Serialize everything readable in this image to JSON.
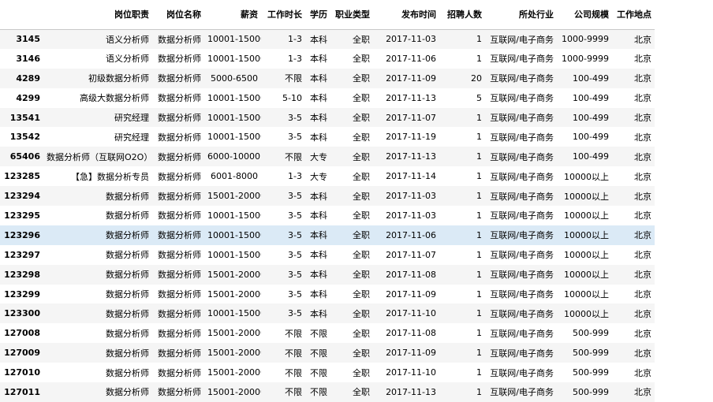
{
  "table": {
    "columns": [
      "",
      "岗位职责",
      "岗位名称",
      "薪资",
      "工作时长",
      "学历",
      "职业类型",
      "发布时间",
      "招聘人数",
      "所处行业",
      "公司规模",
      "工作地点"
    ],
    "rows": [
      [
        "3145",
        "语义分析师",
        "数据分析师",
        "10001-15000",
        "1-3",
        "本科",
        "全职",
        "2017-11-03",
        "1",
        "互联网/电子商务",
        "1000-9999",
        "北京"
      ],
      [
        "3146",
        "语义分析师",
        "数据分析师",
        "10001-15000",
        "1-3",
        "本科",
        "全职",
        "2017-11-06",
        "1",
        "互联网/电子商务",
        "1000-9999",
        "北京"
      ],
      [
        "4289",
        "初级数据分析师",
        "数据分析师",
        "5000-6500",
        "不限",
        "本科",
        "全职",
        "2017-11-09",
        "20",
        "互联网/电子商务",
        "100-499",
        "北京"
      ],
      [
        "4299",
        "高级大数据分析师",
        "数据分析师",
        "10001-15000",
        "5-10",
        "本科",
        "全职",
        "2017-11-13",
        "5",
        "互联网/电子商务",
        "100-499",
        "北京"
      ],
      [
        "13541",
        "研究经理",
        "数据分析师",
        "10001-15000",
        "3-5",
        "本科",
        "全职",
        "2017-11-07",
        "1",
        "互联网/电子商务",
        "100-499",
        "北京"
      ],
      [
        "13542",
        "研究经理",
        "数据分析师",
        "10001-15000",
        "3-5",
        "本科",
        "全职",
        "2017-11-19",
        "1",
        "互联网/电子商务",
        "100-499",
        "北京"
      ],
      [
        "65406",
        "数据分析师（互联网O2O）",
        "数据分析师",
        "6000-10000",
        "不限",
        "大专",
        "全职",
        "2017-11-13",
        "1",
        "互联网/电子商务",
        "100-499",
        "北京"
      ],
      [
        "123285",
        "【急】数据分析专员",
        "数据分析师",
        "6001-8000",
        "1-3",
        "大专",
        "全职",
        "2017-11-14",
        "1",
        "互联网/电子商务",
        "10000以上",
        "北京"
      ],
      [
        "123294",
        "数据分析师",
        "数据分析师",
        "15001-20000",
        "3-5",
        "本科",
        "全职",
        "2017-11-03",
        "1",
        "互联网/电子商务",
        "10000以上",
        "北京"
      ],
      [
        "123295",
        "数据分析师",
        "数据分析师",
        "10001-15000",
        "3-5",
        "本科",
        "全职",
        "2017-11-03",
        "1",
        "互联网/电子商务",
        "10000以上",
        "北京"
      ],
      [
        "123296",
        "数据分析师",
        "数据分析师",
        "10001-15000",
        "3-5",
        "本科",
        "全职",
        "2017-11-06",
        "1",
        "互联网/电子商务",
        "10000以上",
        "北京"
      ],
      [
        "123297",
        "数据分析师",
        "数据分析师",
        "10001-15000",
        "3-5",
        "本科",
        "全职",
        "2017-11-07",
        "1",
        "互联网/电子商务",
        "10000以上",
        "北京"
      ],
      [
        "123298",
        "数据分析师",
        "数据分析师",
        "15001-20000",
        "3-5",
        "本科",
        "全职",
        "2017-11-08",
        "1",
        "互联网/电子商务",
        "10000以上",
        "北京"
      ],
      [
        "123299",
        "数据分析师",
        "数据分析师",
        "15001-20000",
        "3-5",
        "本科",
        "全职",
        "2017-11-09",
        "1",
        "互联网/电子商务",
        "10000以上",
        "北京"
      ],
      [
        "123300",
        "数据分析师",
        "数据分析师",
        "10001-15000",
        "3-5",
        "本科",
        "全职",
        "2017-11-10",
        "1",
        "互联网/电子商务",
        "10000以上",
        "北京"
      ],
      [
        "127008",
        "数据分析师",
        "数据分析师",
        "15001-20000",
        "不限",
        "不限",
        "全职",
        "2017-11-08",
        "1",
        "互联网/电子商务",
        "500-999",
        "北京"
      ],
      [
        "127009",
        "数据分析师",
        "数据分析师",
        "15001-20000",
        "不限",
        "不限",
        "全职",
        "2017-11-09",
        "1",
        "互联网/电子商务",
        "500-999",
        "北京"
      ],
      [
        "127010",
        "数据分析师",
        "数据分析师",
        "15001-20000",
        "不限",
        "不限",
        "全职",
        "2017-11-10",
        "1",
        "互联网/电子商务",
        "500-999",
        "北京"
      ],
      [
        "127011",
        "数据分析师",
        "数据分析师",
        "15001-20000",
        "不限",
        "不限",
        "全职",
        "2017-11-13",
        "1",
        "互联网/电子商务",
        "500-999",
        "北京"
      ]
    ],
    "highlight_row": 10,
    "highlight_color": "#dbeaf6",
    "stripe_color": "#f5f5f5"
  }
}
